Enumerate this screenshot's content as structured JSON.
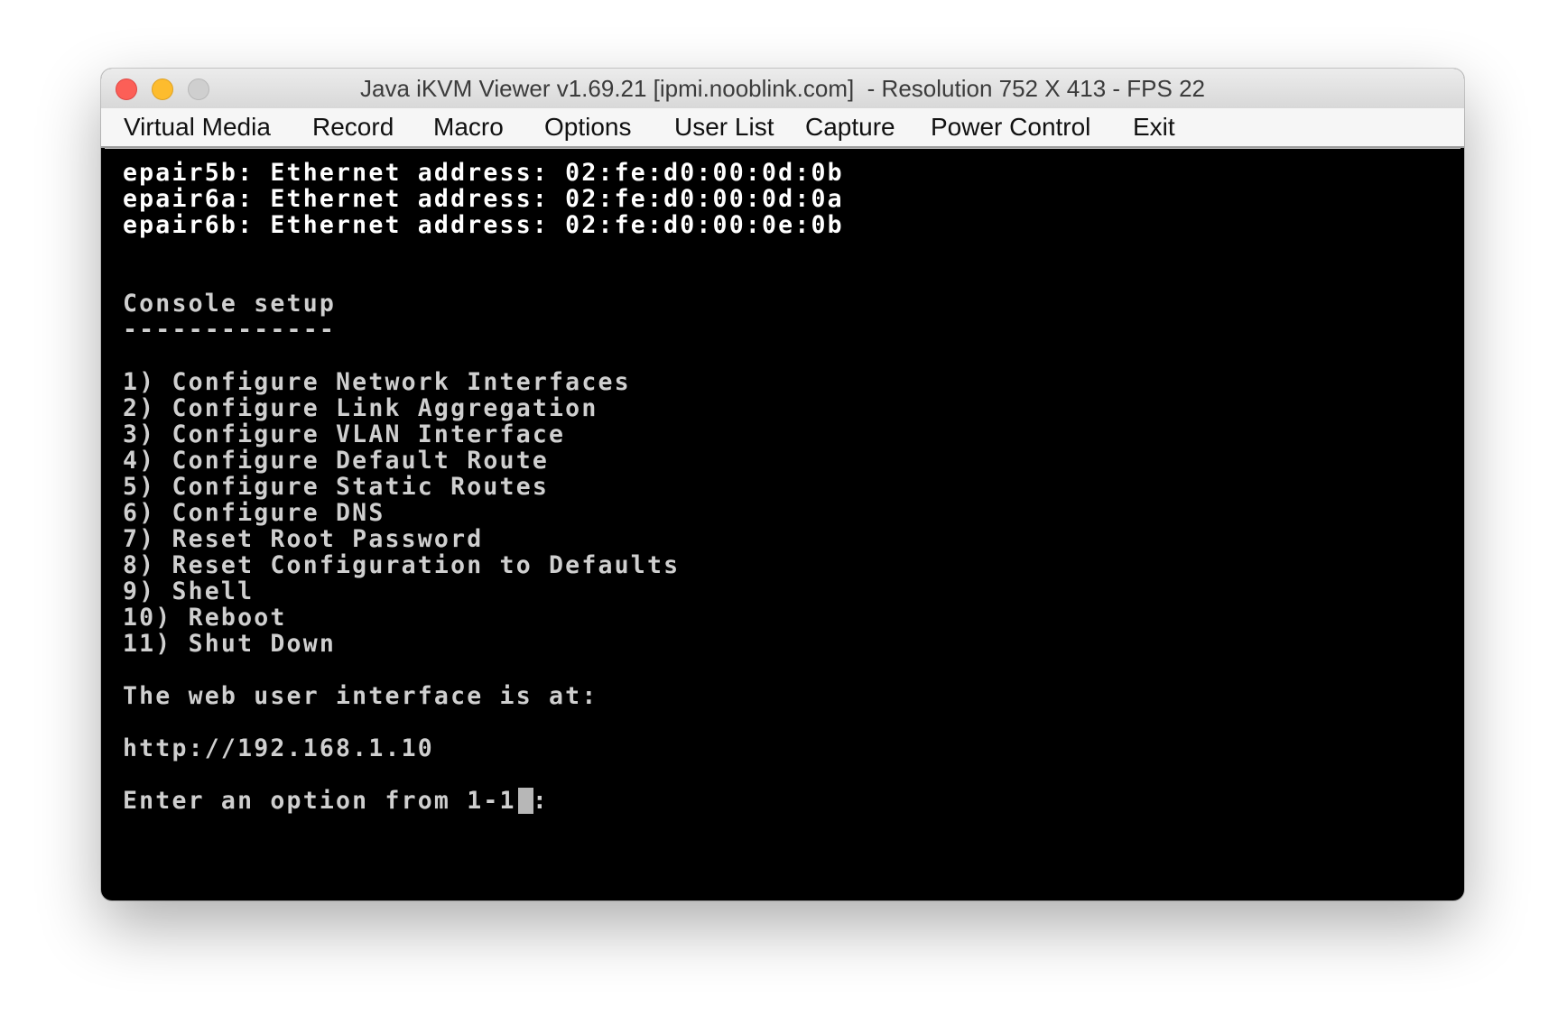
{
  "window": {
    "title": "Java iKVM Viewer v1.69.21 [ipmi.nooblink.com]  - Resolution 752 X 413 - FPS 22"
  },
  "menu": {
    "items": [
      {
        "label": "Virtual Media"
      },
      {
        "label": "Record"
      },
      {
        "label": "Macro"
      },
      {
        "label": "Options"
      },
      {
        "label": "User List"
      },
      {
        "label": "Capture"
      },
      {
        "label": "Power Control"
      },
      {
        "label": "Exit"
      }
    ]
  },
  "console": {
    "ethernet_lines": [
      "epair5b: Ethernet address: 02:fe:d0:00:0d:0b",
      "epair6a: Ethernet address: 02:fe:d0:00:0d:0a",
      "epair6b: Ethernet address: 02:fe:d0:00:0e:0b"
    ],
    "heading": "Console setup",
    "underline": "-------------",
    "options": [
      "1) Configure Network Interfaces",
      "2) Configure Link Aggregation",
      "3) Configure VLAN Interface",
      "4) Configure Default Route",
      "5) Configure Static Routes",
      "6) Configure DNS",
      "7) Reset Root Password",
      "8) Reset Configuration to Defaults",
      "9) Shell",
      "10) Reboot",
      "11) Shut Down"
    ],
    "web_ui_text": "The web user interface is at:",
    "url": "http://192.168.1.10",
    "prompt": "Enter an option from 1-11: "
  }
}
